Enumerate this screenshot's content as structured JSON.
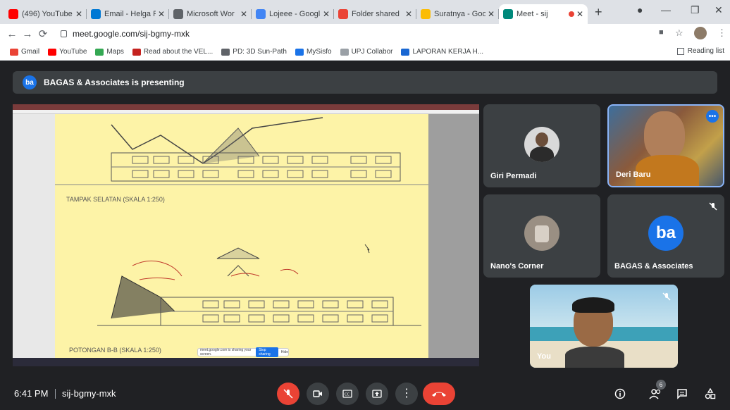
{
  "browser": {
    "tabs": [
      {
        "title": "(496) YouTube",
        "icon": "youtube-icon",
        "color": "#ff0000"
      },
      {
        "title": "Email - Helga F",
        "icon": "outlook-icon",
        "color": "#0078d4"
      },
      {
        "title": "Microsoft Wor",
        "icon": "globe-icon",
        "color": "#5f6368"
      },
      {
        "title": "Lojeee - Googl",
        "icon": "docs-icon",
        "color": "#4285f4"
      },
      {
        "title": "Folder shared",
        "icon": "gmail-icon",
        "color": "#ea4335"
      },
      {
        "title": "Suratnya - Goo",
        "icon": "drive-icon",
        "color": "#fbbc04"
      },
      {
        "title": "Meet - sij",
        "icon": "meet-icon",
        "color": "#00897b"
      }
    ],
    "url": "meet.google.com/sij-bgmy-mxk",
    "bookmarks": [
      {
        "label": "Gmail",
        "color": "#ea4335"
      },
      {
        "label": "YouTube",
        "color": "#ff0000"
      },
      {
        "label": "Maps",
        "color": "#34a853"
      },
      {
        "label": "Read about the VEL...",
        "color": "#c5221f"
      },
      {
        "label": "PD: 3D Sun-Path",
        "color": "#5f6368"
      },
      {
        "label": "MySisfo",
        "color": "#1a73e8"
      },
      {
        "label": "UPJ Collabor",
        "color": "#9aa0a6"
      },
      {
        "label": "LAPORAN KERJA H...",
        "color": "#1967d2"
      }
    ],
    "reading_list": "Reading list"
  },
  "meet": {
    "presenting_banner": "BAGAS & Associates is presenting",
    "logo_text": "ba",
    "drawing_labels": {
      "south": "TAMPAK SELATAN (SKALA 1:250)",
      "section": "POTONGAN B-B (SKALA 1:250)",
      "share_msg": "meet.google.com is sharing your screen.",
      "stop_sharing": "Stop sharing",
      "hide": "Hide"
    },
    "participants": [
      {
        "name": "Giri Permadi"
      },
      {
        "name": "Deri Baru"
      },
      {
        "name": "Nano's Corner"
      },
      {
        "name": "BAGAS & Associates"
      },
      {
        "name": "You"
      }
    ],
    "time": "6:41 PM",
    "meeting_code": "sij-bgmy-mxk",
    "participant_count": "6",
    "colors": {
      "accent": "#1a73e8",
      "end_call": "#ea4335",
      "bg": "#202124",
      "tile": "#3c4043"
    }
  }
}
